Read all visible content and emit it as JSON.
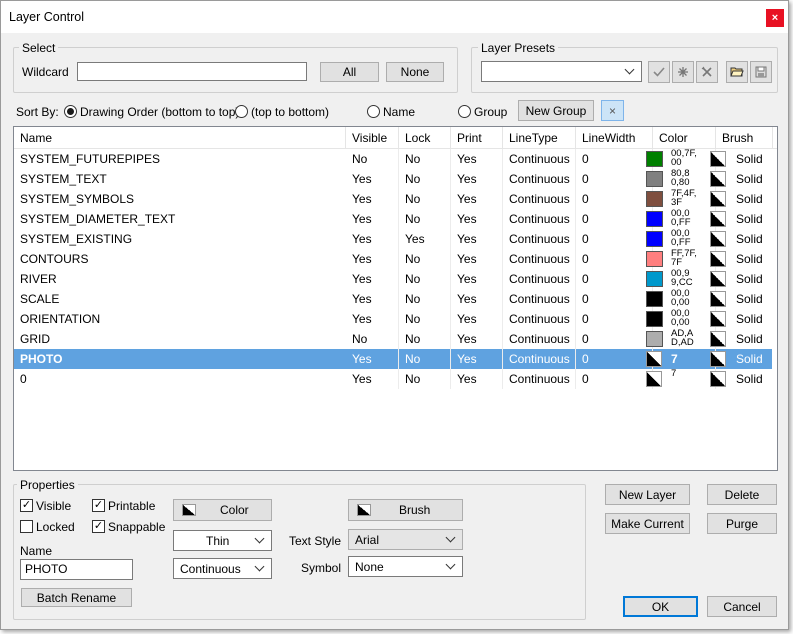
{
  "window": {
    "title": "Layer Control",
    "close_glyph": "×"
  },
  "select": {
    "group_label": "Select",
    "wildcard_label": "Wildcard",
    "wildcard_value": "",
    "all_label": "All",
    "none_label": "None"
  },
  "presets": {
    "group_label": "Layer Presets",
    "value": "",
    "icons": [
      "check-icon",
      "star-icon",
      "delete-icon",
      "open-folder-icon",
      "save-icon"
    ]
  },
  "sort": {
    "label": "Sort By:",
    "options": [
      "Drawing Order (bottom to top)",
      "(top to bottom)",
      "Name",
      "Group"
    ],
    "selected_index": 0,
    "new_group_label": "New Group",
    "clear_glyph": "×"
  },
  "table": {
    "columns": [
      "Name",
      "Visible",
      "Lock",
      "Print",
      "LineType",
      "LineWidth",
      "Color",
      "Brush"
    ],
    "rows": [
      {
        "name": "SYSTEM_FUTUREPIPES",
        "visible": "No",
        "lock": "No",
        "print": "Yes",
        "linetype": "Continuous",
        "linewidth": "0",
        "color": "#008000",
        "color_text": "00,7F,00",
        "brush": "Solid"
      },
      {
        "name": "SYSTEM_TEXT",
        "visible": "Yes",
        "lock": "No",
        "print": "Yes",
        "linetype": "Continuous",
        "linewidth": "0",
        "color": "#808080",
        "color_text": "80,80,80",
        "brush": "Solid"
      },
      {
        "name": "SYSTEM_SYMBOLS",
        "visible": "Yes",
        "lock": "No",
        "print": "Yes",
        "linetype": "Continuous",
        "linewidth": "0",
        "color": "#7f4f3f",
        "color_text": "7F,4F,3F",
        "brush": "Solid"
      },
      {
        "name": "SYSTEM_DIAMETER_TEXT",
        "visible": "Yes",
        "lock": "No",
        "print": "Yes",
        "linetype": "Continuous",
        "linewidth": "0",
        "color": "#0000ff",
        "color_text": "00,00,FF",
        "brush": "Solid"
      },
      {
        "name": "SYSTEM_EXISTING",
        "visible": "Yes",
        "lock": "Yes",
        "print": "Yes",
        "linetype": "Continuous",
        "linewidth": "0",
        "color": "#0000ff",
        "color_text": "00,00,FF",
        "brush": "Solid"
      },
      {
        "name": "CONTOURS",
        "visible": "Yes",
        "lock": "No",
        "print": "Yes",
        "linetype": "Continuous",
        "linewidth": "0",
        "color": "#ff7f7f",
        "color_text": "FF,7F,7F",
        "brush": "Solid"
      },
      {
        "name": "RIVER",
        "visible": "Yes",
        "lock": "No",
        "print": "Yes",
        "linetype": "Continuous",
        "linewidth": "0",
        "color": "#0099cc",
        "color_text": "00,99,CC",
        "brush": "Solid"
      },
      {
        "name": "SCALE",
        "visible": "Yes",
        "lock": "No",
        "print": "Yes",
        "linetype": "Continuous",
        "linewidth": "0",
        "color": "#000000",
        "color_text": "00,00,00",
        "brush": "Solid"
      },
      {
        "name": "ORIENTATION",
        "visible": "Yes",
        "lock": "No",
        "print": "Yes",
        "linetype": "Continuous",
        "linewidth": "0",
        "color": "#000000",
        "color_text": "00,00,00",
        "brush": "Solid"
      },
      {
        "name": "GRID",
        "visible": "No",
        "lock": "No",
        "print": "Yes",
        "linetype": "Continuous",
        "linewidth": "0",
        "color": "#adadad",
        "color_text": "AD,AD,AD",
        "brush": "Solid"
      },
      {
        "name": "PHOTO",
        "visible": "Yes",
        "lock": "No",
        "print": "Yes",
        "linetype": "Continuous",
        "linewidth": "0",
        "color": null,
        "color_text": "7",
        "brush": "Solid",
        "selected": true
      },
      {
        "name": "0",
        "visible": "Yes",
        "lock": "No",
        "print": "Yes",
        "linetype": "Continuous",
        "linewidth": "0",
        "color": null,
        "color_text": "7",
        "brush": "Solid"
      }
    ]
  },
  "properties": {
    "group_label": "Properties",
    "visible_label": "Visible",
    "visible_checked": true,
    "locked_label": "Locked",
    "locked_checked": false,
    "printable_label": "Printable",
    "printable_checked": true,
    "snappable_label": "Snappable",
    "snappable_checked": true,
    "color_button": "Color",
    "brush_button": "Brush",
    "lineweight_value": "Thin",
    "linetype_value": "Continuous",
    "name_label": "Name",
    "name_value": "PHOTO",
    "batch_rename": "Batch Rename",
    "text_style_label": "Text Style",
    "text_style_value": "Arial",
    "symbol_label": "Symbol",
    "symbol_value": "None"
  },
  "actions": {
    "new_layer": "New Layer",
    "delete": "Delete",
    "make_current": "Make Current",
    "purge": "Purge",
    "ok": "OK",
    "cancel": "Cancel"
  }
}
